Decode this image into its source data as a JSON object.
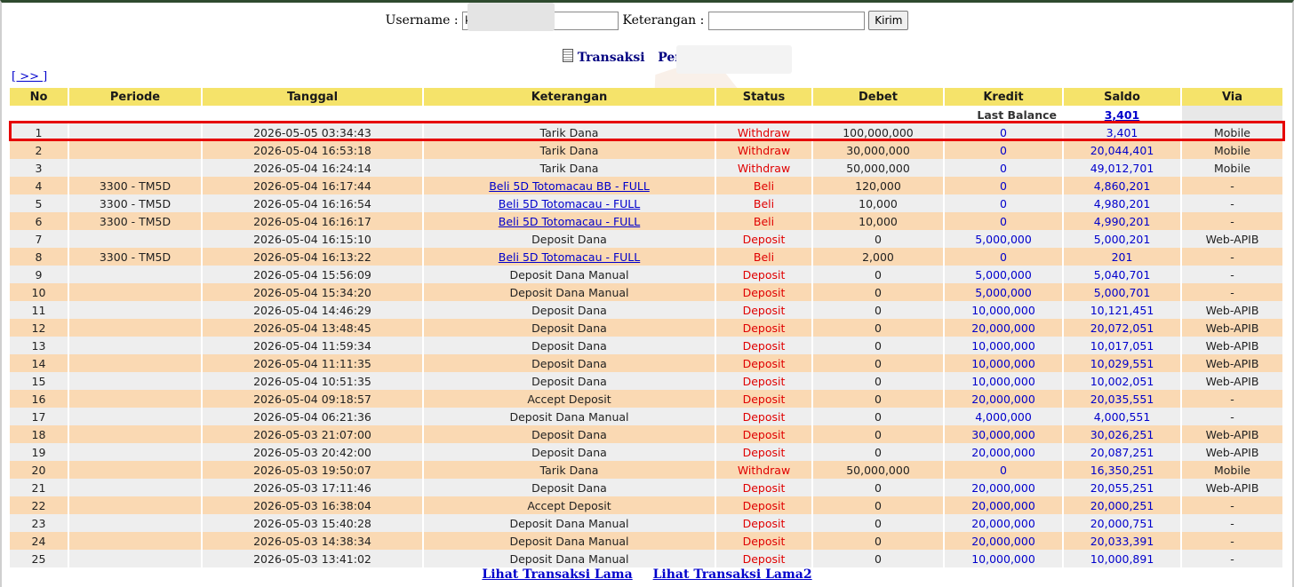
{
  "form": {
    "username_label": "Username :",
    "username_value": "k",
    "keterangan_label": "Keterangan :",
    "keterangan_value": "",
    "submit_label": "Kirim"
  },
  "heading": {
    "title": "Transaksi",
    "player_label": "Pemain : k"
  },
  "nav": {
    "next_label": "[ >> ]"
  },
  "columns": [
    "No",
    "Periode",
    "Tanggal",
    "Keterangan",
    "Status",
    "Debet",
    "Kredit",
    "Saldo",
    "Via"
  ],
  "last_balance": {
    "label": "Last Balance",
    "value": "3,401"
  },
  "rows": [
    {
      "no": "1",
      "periode": "",
      "tanggal": "2026-05-05 03:34:43",
      "ket": "Tarik Dana",
      "link": false,
      "status": "Withdraw",
      "debet": "100,000,000",
      "kredit": "0",
      "saldo": "3,401",
      "via": "Mobile"
    },
    {
      "no": "2",
      "periode": "",
      "tanggal": "2026-05-04 16:53:18",
      "ket": "Tarik Dana",
      "link": false,
      "status": "Withdraw",
      "debet": "30,000,000",
      "kredit": "0",
      "saldo": "20,044,401",
      "via": "Mobile"
    },
    {
      "no": "3",
      "periode": "",
      "tanggal": "2026-05-04 16:24:14",
      "ket": "Tarik Dana",
      "link": false,
      "status": "Withdraw",
      "debet": "50,000,000",
      "kredit": "0",
      "saldo": "49,012,701",
      "via": "Mobile"
    },
    {
      "no": "4",
      "periode": "3300 - TM5D",
      "tanggal": "2026-05-04 16:17:44",
      "ket": "Beli 5D Totomacau BB - FULL",
      "link": true,
      "status": "Beli",
      "debet": "120,000",
      "kredit": "0",
      "saldo": "4,860,201",
      "via": "-"
    },
    {
      "no": "5",
      "periode": "3300 - TM5D",
      "tanggal": "2026-05-04 16:16:54",
      "ket": "Beli 5D Totomacau - FULL",
      "link": true,
      "status": "Beli",
      "debet": "10,000",
      "kredit": "0",
      "saldo": "4,980,201",
      "via": "-"
    },
    {
      "no": "6",
      "periode": "3300 - TM5D",
      "tanggal": "2026-05-04 16:16:17",
      "ket": "Beli 5D Totomacau - FULL",
      "link": true,
      "status": "Beli",
      "debet": "10,000",
      "kredit": "0",
      "saldo": "4,990,201",
      "via": "-"
    },
    {
      "no": "7",
      "periode": "",
      "tanggal": "2026-05-04 16:15:10",
      "ket": "Deposit Dana",
      "link": false,
      "status": "Deposit",
      "debet": "0",
      "kredit": "5,000,000",
      "saldo": "5,000,201",
      "via": "Web-APIB"
    },
    {
      "no": "8",
      "periode": "3300 - TM5D",
      "tanggal": "2026-05-04 16:13:22",
      "ket": "Beli 5D Totomacau - FULL",
      "link": true,
      "status": "Beli",
      "debet": "2,000",
      "kredit": "0",
      "saldo": "201",
      "via": "-"
    },
    {
      "no": "9",
      "periode": "",
      "tanggal": "2026-05-04 15:56:09",
      "ket": "Deposit Dana Manual",
      "link": false,
      "status": "Deposit",
      "debet": "0",
      "kredit": "5,000,000",
      "saldo": "5,040,701",
      "via": "-"
    },
    {
      "no": "10",
      "periode": "",
      "tanggal": "2026-05-04 15:34:20",
      "ket": "Deposit Dana Manual",
      "link": false,
      "status": "Deposit",
      "debet": "0",
      "kredit": "5,000,000",
      "saldo": "5,000,701",
      "via": "-"
    },
    {
      "no": "11",
      "periode": "",
      "tanggal": "2026-05-04 14:46:29",
      "ket": "Deposit Dana",
      "link": false,
      "status": "Deposit",
      "debet": "0",
      "kredit": "10,000,000",
      "saldo": "10,121,451",
      "via": "Web-APIB"
    },
    {
      "no": "12",
      "periode": "",
      "tanggal": "2026-05-04 13:48:45",
      "ket": "Deposit Dana",
      "link": false,
      "status": "Deposit",
      "debet": "0",
      "kredit": "20,000,000",
      "saldo": "20,072,051",
      "via": "Web-APIB"
    },
    {
      "no": "13",
      "periode": "",
      "tanggal": "2026-05-04 11:59:34",
      "ket": "Deposit Dana",
      "link": false,
      "status": "Deposit",
      "debet": "0",
      "kredit": "10,000,000",
      "saldo": "10,017,051",
      "via": "Web-APIB"
    },
    {
      "no": "14",
      "periode": "",
      "tanggal": "2026-05-04 11:11:35",
      "ket": "Deposit Dana",
      "link": false,
      "status": "Deposit",
      "debet": "0",
      "kredit": "10,000,000",
      "saldo": "10,029,551",
      "via": "Web-APIB"
    },
    {
      "no": "15",
      "periode": "",
      "tanggal": "2026-05-04 10:51:35",
      "ket": "Deposit Dana",
      "link": false,
      "status": "Deposit",
      "debet": "0",
      "kredit": "10,000,000",
      "saldo": "10,002,051",
      "via": "Web-APIB"
    },
    {
      "no": "16",
      "periode": "",
      "tanggal": "2026-05-04 09:18:57",
      "ket": "Accept Deposit",
      "link": false,
      "status": "Deposit",
      "debet": "0",
      "kredit": "20,000,000",
      "saldo": "20,035,551",
      "via": "-"
    },
    {
      "no": "17",
      "periode": "",
      "tanggal": "2026-05-04 06:21:36",
      "ket": "Deposit Dana Manual",
      "link": false,
      "status": "Deposit",
      "debet": "0",
      "kredit": "4,000,000",
      "saldo": "4,000,551",
      "via": "-"
    },
    {
      "no": "18",
      "periode": "",
      "tanggal": "2026-05-03 21:07:00",
      "ket": "Deposit Dana",
      "link": false,
      "status": "Deposit",
      "debet": "0",
      "kredit": "30,000,000",
      "saldo": "30,026,251",
      "via": "Web-APIB"
    },
    {
      "no": "19",
      "periode": "",
      "tanggal": "2026-05-03 20:42:00",
      "ket": "Deposit Dana",
      "link": false,
      "status": "Deposit",
      "debet": "0",
      "kredit": "20,000,000",
      "saldo": "20,087,251",
      "via": "Web-APIB"
    },
    {
      "no": "20",
      "periode": "",
      "tanggal": "2026-05-03 19:50:07",
      "ket": "Tarik Dana",
      "link": false,
      "status": "Withdraw",
      "debet": "50,000,000",
      "kredit": "0",
      "saldo": "16,350,251",
      "via": "Mobile"
    },
    {
      "no": "21",
      "periode": "",
      "tanggal": "2026-05-03 17:11:46",
      "ket": "Deposit Dana",
      "link": false,
      "status": "Deposit",
      "debet": "0",
      "kredit": "20,000,000",
      "saldo": "20,055,251",
      "via": "Web-APIB"
    },
    {
      "no": "22",
      "periode": "",
      "tanggal": "2026-05-03 16:38:04",
      "ket": "Accept Deposit",
      "link": false,
      "status": "Deposit",
      "debet": "0",
      "kredit": "20,000,000",
      "saldo": "20,000,251",
      "via": "-"
    },
    {
      "no": "23",
      "periode": "",
      "tanggal": "2026-05-03 15:40:28",
      "ket": "Deposit Dana Manual",
      "link": false,
      "status": "Deposit",
      "debet": "0",
      "kredit": "20,000,000",
      "saldo": "20,000,751",
      "via": "-"
    },
    {
      "no": "24",
      "periode": "",
      "tanggal": "2026-05-03 14:38:34",
      "ket": "Deposit Dana Manual",
      "link": false,
      "status": "Deposit",
      "debet": "0",
      "kredit": "20,000,000",
      "saldo": "20,033,391",
      "via": "-"
    },
    {
      "no": "25",
      "periode": "",
      "tanggal": "2026-05-03 13:41:02",
      "ket": "Deposit Dana Manual",
      "link": false,
      "status": "Deposit",
      "debet": "0",
      "kredit": "10,000,000",
      "saldo": "10,000,891",
      "via": "-"
    }
  ],
  "footer": {
    "link1": "Lihat Transaksi Lama",
    "link2": "Lihat Transaksi Lama2"
  },
  "colors": {
    "header_bg": "#f5e36a",
    "row_odd": "#eeeeee",
    "row_even": "#fad9b3",
    "status_red": "#e00000",
    "link_blue": "#0000cc",
    "highlight_border": "#e60000"
  },
  "highlighted_row": "1"
}
